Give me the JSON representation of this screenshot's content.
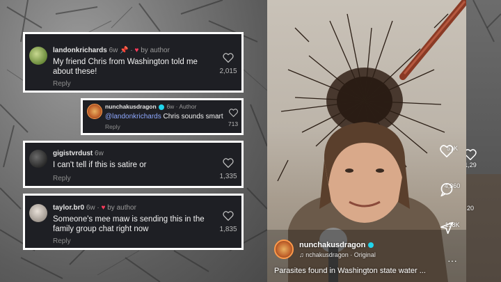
{
  "comments": [
    {
      "username": "landonkrichards",
      "meta": "6w",
      "author_tag": "by author",
      "text_line1": "My friend Chris from Washington told me",
      "text_line2": "about these!",
      "reply_label": "Reply",
      "likes": "2,015"
    },
    {
      "username": "nunchakusdragon",
      "meta": "6w · Author",
      "mention": "@landonkrichards",
      "text": " Chris sounds smart",
      "reply_label": "Reply",
      "likes": "713"
    },
    {
      "username": "gigistvrdust",
      "meta": "6w",
      "text_line1": "I can't tell if this is satire or",
      "reply_label": "Reply",
      "likes": "1,335"
    },
    {
      "username": "taylor.br0",
      "meta": "6w",
      "author_tag": "by author",
      "text_line1": "Someone's mee maw is sending this in the",
      "text_line2": "family group chat right now",
      "reply_label": "Reply",
      "likes": "1,835"
    }
  ],
  "video": {
    "creator": "nunchakusdragon",
    "sound": "nchakusdragon · Original",
    "caption": "Parasites found in Washington state water ..."
  },
  "rail": {
    "likes": "51K",
    "comments": "4,360",
    "shares": "138K",
    "likes_partial": "1,29",
    "comments_partial": "20"
  },
  "colors": {
    "card_bg": "#1e1f24",
    "card_border": "#ffffff",
    "mention": "#8fa9ff",
    "heart_red": "#ff3b5c",
    "verified": "#20d5ec"
  }
}
